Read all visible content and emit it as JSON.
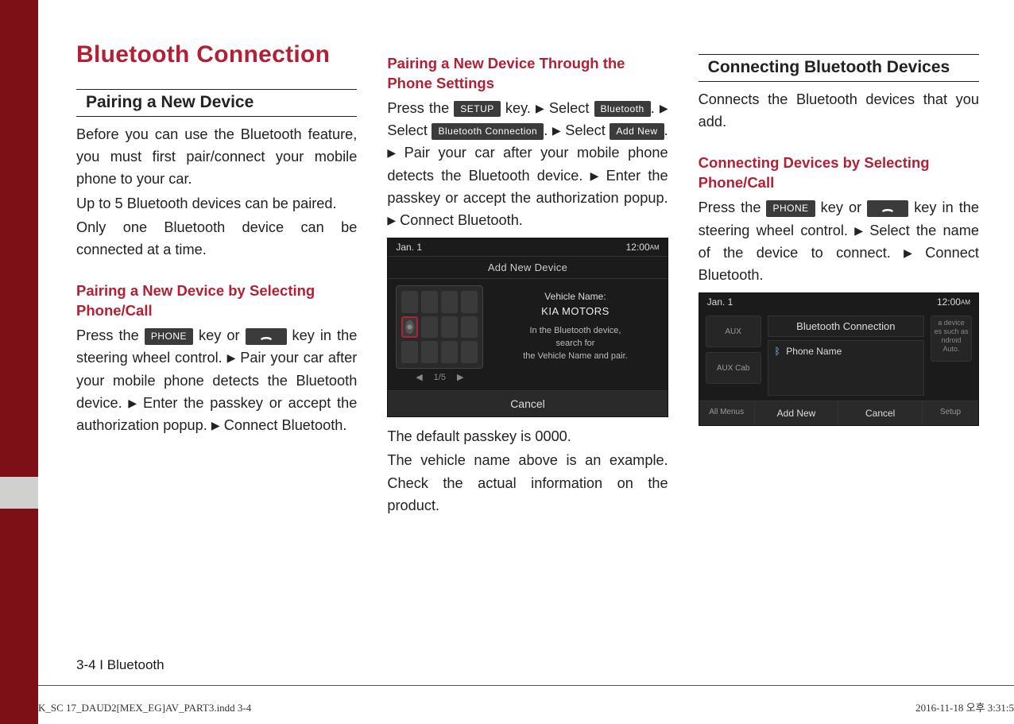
{
  "title": "Bluetooth Connection",
  "section1": {
    "heading": "Pairing a New Device",
    "p1": "Before you can use the Bluetooth feature, you must first pair/connect your mobile phone to your car.",
    "p2": "Up to 5 Bluetooth devices can be paired.",
    "p3": "Only one Bluetooth device can be connected at a time."
  },
  "sub1": {
    "heading": "Pairing a New Device by Selecting Phone/Call",
    "t1": "Press the ",
    "key_phone": "PHONE",
    "t2": " key or ",
    "t3": " key in the steering wheel control. ",
    "t4": " Pair your car after your mobile phone detects the Bluetooth device. ",
    "t5": " Enter the passkey or accept the authorization popup. ",
    "t6": " Connect Bluetooth."
  },
  "sub2": {
    "heading": "Pairing a New Device Through the Phone Settings",
    "t1": "Press the ",
    "key_setup": "SETUP",
    "t2": " key. ",
    "t3": " Select ",
    "key_bt": "Bluetooth",
    "t4": ". ",
    "t5": " Select ",
    "key_btc": "Bluetooth Connection",
    "t6": ". ",
    "t7": " Select ",
    "key_addnew": "Add New",
    "t8": ". ",
    "t9": " Pair your car after your mobile phone detects the Bluetooth device. ",
    "t10": " Enter the passkey or accept the authorization popup. ",
    "t11": " Connect Bluetooth."
  },
  "shot1": {
    "date": "Jan. 1",
    "time": "12:00",
    "ampm": "AM",
    "title": "Add New Device",
    "vehicle_label": "Vehicle Name:",
    "vehicle_name": "KIA MOTORS",
    "hint1": "In the Bluetooth device,",
    "hint2": "search for",
    "hint3": "the Vehicle Name and pair.",
    "pager": "1/5",
    "cancel": "Cancel"
  },
  "after_shot1_a": "The default passkey is 0000.",
  "after_shot1_b": "The vehicle name above is an example. Check the actual information on the product.",
  "section2": {
    "heading": "Connecting Bluetooth Devices",
    "p1": "Connects the Bluetooth devices that you add."
  },
  "sub3": {
    "heading": "Connecting Devices by Selecting Phone/Call",
    "t1": "Press the ",
    "key_phone": "PHONE",
    "t2": " key or ",
    "t3": " key in the steering wheel control. ",
    "t4": " Select the name of the device to connect. ",
    "t5": " Connect Bluetooth."
  },
  "shot2": {
    "date": "Jan. 1",
    "time": "12:00",
    "ampm": "AM",
    "aux": "AUX",
    "aux2": "AUX Cab",
    "panel": "Bluetooth Connection",
    "item": "Phone Name",
    "right1": "a device es such as ndroid Auto.",
    "allmenus": "All Menus",
    "addnew": "Add New",
    "cancel": "Cancel",
    "setup": "Setup"
  },
  "page_number": "3-4 I Bluetooth",
  "footer_left": "K_SC 17_DAUD2[MEX_EG]AV_PART3.indd   3-4",
  "footer_right": "2016-11-18   오후 3:31:5",
  "tri": "▶"
}
